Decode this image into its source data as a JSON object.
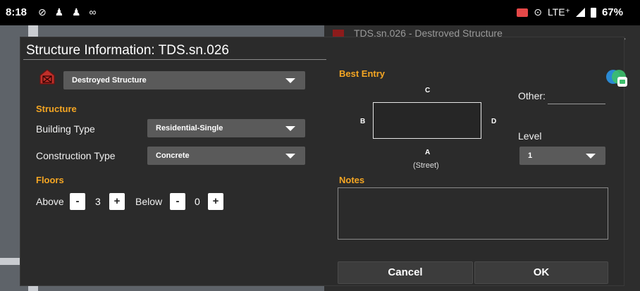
{
  "status_bar": {
    "time": "8:18",
    "notification_icons": "⊘ ♟ ♟ ∞",
    "location_glyph": "⊙",
    "network": "LTE⁺",
    "battery": "67%"
  },
  "background": {
    "dialog_title": "TDS.sn.026 - Destroyed Structure"
  },
  "dialog": {
    "title": "Structure Information: TDS.sn.026",
    "structure_type": {
      "value": "Destroyed Structure"
    },
    "structure_section": "Structure",
    "building_type": {
      "label": "Building Type",
      "value": "Residential-Single"
    },
    "construction_type": {
      "label": "Construction Type",
      "value": "Concrete"
    },
    "floors_section": "Floors",
    "floors": {
      "above_label": "Above",
      "above_value": "3",
      "below_label": "Below",
      "below_value": "0",
      "minus": "-",
      "plus": "+"
    },
    "best_entry": {
      "title": "Best Entry",
      "side_a": "A",
      "side_a_sub": "(Street)",
      "side_b": "B",
      "side_c": "C",
      "side_d": "D"
    },
    "other_label": "Other:",
    "level": {
      "label": "Level",
      "value": "1"
    },
    "notes_label": "Notes",
    "cancel_label": "Cancel",
    "ok_label": "OK"
  },
  "colors": {
    "section_accent": "#f5a623",
    "dialog_bg": "#2b2b2b",
    "combo_bg": "#5a5a5a"
  }
}
